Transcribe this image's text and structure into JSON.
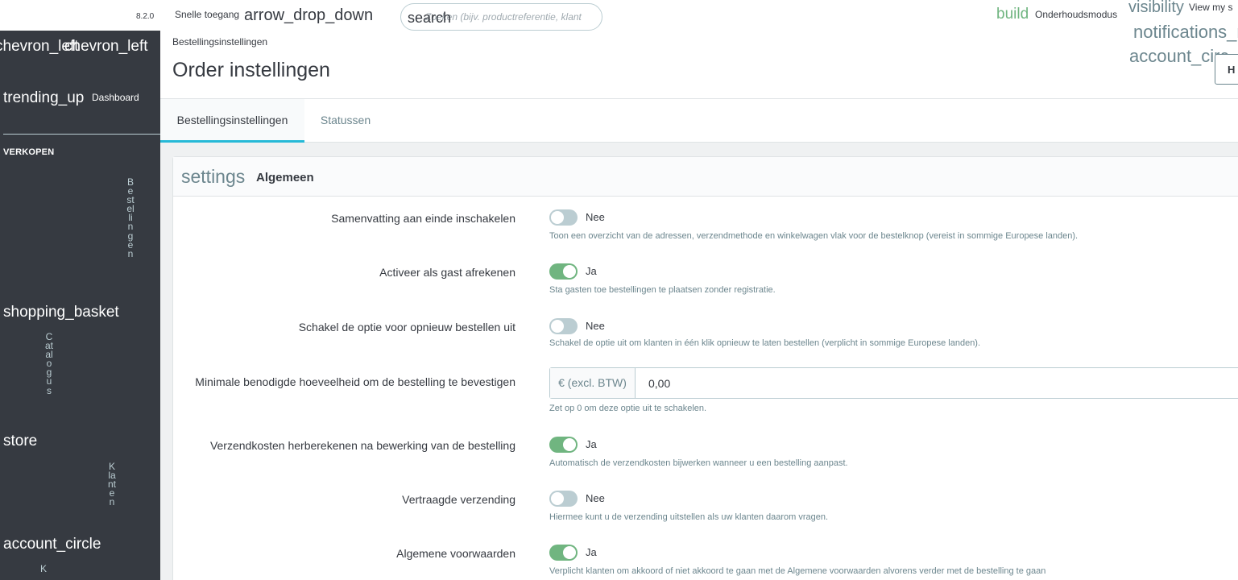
{
  "app": {
    "version": "8.2.0"
  },
  "sidebar": {
    "collapse_icons": [
      "chevron_left",
      "chevron_left"
    ],
    "dashboard": {
      "icon": "trending_up",
      "label": "Dashboard"
    },
    "section_label": "VERKOPEN",
    "items": [
      {
        "icon": "shopping_basket",
        "label": "Bestellingen"
      },
      {
        "icon": "store",
        "label": "Catalogus"
      },
      {
        "icon": "account_circle",
        "label": "Klanten"
      },
      {
        "label": "K"
      }
    ]
  },
  "header": {
    "quick_access": "Snelle toegang",
    "quick_access_icon": "arrow_drop_down",
    "search_icon": "search",
    "search_placeholder": "Zoeken (bijv. productreferentie, klant",
    "build_icon": "build",
    "maintenance": "Onderhoudsmodus",
    "visibility_icon": "visibility",
    "view_shop": "View my s",
    "notifications_icon": "notifications_n",
    "account_icon": "account_circ",
    "help_label": "H"
  },
  "page": {
    "breadcrumb": "Bestellingsinstellingen",
    "title": "Order instellingen"
  },
  "tabs": [
    {
      "label": "Bestellingsinstellingen",
      "active": true
    },
    {
      "label": "Statussen",
      "active": false
    }
  ],
  "card": {
    "icon": "settings",
    "title": "Algemeen"
  },
  "settings": [
    {
      "label": "Samenvatting aan einde inschakelen",
      "state": "Nee",
      "on": false,
      "help": "Toon een overzicht van de adressen, verzendmethode en winkelwagen vlak voor de bestelknop (vereist in sommige Europese landen)."
    },
    {
      "label": "Activeer als gast afrekenen",
      "state": "Ja",
      "on": true,
      "help": "Sta gasten toe bestellingen te plaatsen zonder registratie."
    },
    {
      "label": "Schakel de optie voor opnieuw bestellen uit",
      "state": "Nee",
      "on": false,
      "help": "Schakel de optie uit om klanten in één klik opnieuw te laten bestellen (verplicht in sommige Europese landen)."
    },
    {
      "label": "Minimale benodigde hoeveelheid om de bestelling te bevestigen",
      "prefix": "€ (excl. BTW)",
      "value": "0,00",
      "help": "Zet op 0 om deze optie uit te schakelen."
    },
    {
      "label": "Verzendkosten herberekenen na bewerking van de bestelling",
      "state": "Ja",
      "on": true,
      "help": "Automatisch de verzendkosten bijwerken wanneer u een bestelling aanpast."
    },
    {
      "label": "Vertraagde verzending",
      "state": "Nee",
      "on": false,
      "help": "Hiermee kunt u de verzending uitstellen als uw klanten daarom vragen."
    },
    {
      "label": "Algemene voorwaarden",
      "state": "Ja",
      "on": true,
      "help": "Verplicht klanten om akkoord of niet akkoord te gaan met de Algemene voorwaarden alvorens verder met de bestelling te gaan"
    }
  ],
  "colors": {
    "sidebar_bg": "#363a41",
    "accent": "#25b9d7",
    "switch_on": "#70b580",
    "switch_off": "#bbcdd2"
  }
}
